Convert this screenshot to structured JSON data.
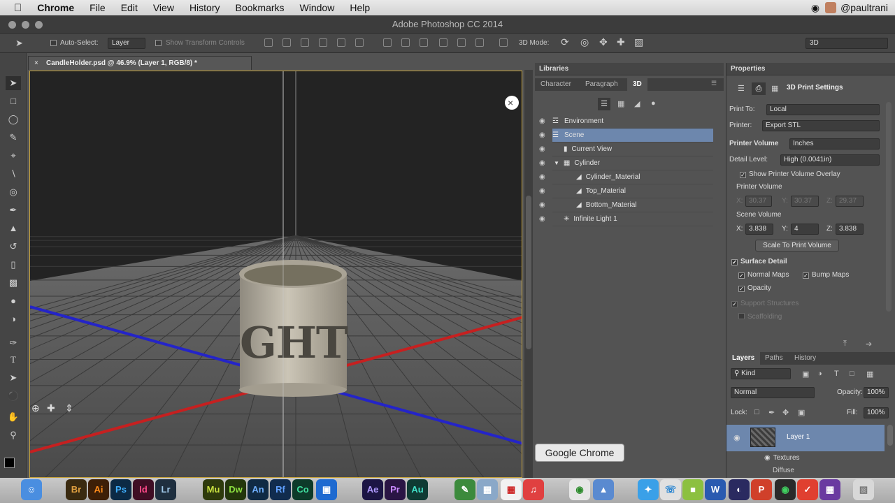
{
  "menubar": {
    "app": "Chrome",
    "items": [
      "File",
      "Edit",
      "View",
      "History",
      "Bookmarks",
      "Window",
      "Help"
    ],
    "user": "@paultrani"
  },
  "window": {
    "title": "Adobe Photoshop CC 2014"
  },
  "options": {
    "auto_select": "Auto-Select:",
    "auto_select_value": "Layer",
    "show_transform": "Show Transform Controls",
    "mode_3d": "3D Mode:",
    "workspace": "3D"
  },
  "document": {
    "tab": "CandleHolder.psd @ 46.9% (Layer 1, RGB/8) *",
    "cylinder_text": "GHT"
  },
  "panels": {
    "libraries": "Libraries",
    "tabs": [
      "Character",
      "Paragraph",
      "3D"
    ],
    "scene_items": [
      "Environment",
      "Scene",
      "Current View",
      "Cylinder",
      "Cylinder_Material",
      "Top_Material",
      "Bottom_Material",
      "Infinite Light 1"
    ]
  },
  "properties": {
    "header": "Properties",
    "title": "3D Print Settings",
    "print_to_label": "Print To:",
    "print_to": "Local",
    "printer_label": "Printer:",
    "printer": "Export STL",
    "printer_volume_label": "Printer Volume",
    "printer_volume_unit": "Inches",
    "detail_label": "Detail Level:",
    "detail": "High (0.0041in)",
    "show_overlay": "Show Printer Volume Overlay",
    "printer_volume": "Printer Volume",
    "pv": {
      "x_label": "X:",
      "x": "30.37",
      "y_label": "Y:",
      "y": "30.37",
      "z_label": "Z:",
      "z": "29.37"
    },
    "scene_volume": "Scene Volume",
    "sv": {
      "x_label": "X:",
      "x": "3.838",
      "y_label": "Y:",
      "y": "4",
      "z_label": "Z:",
      "z": "3.838"
    },
    "scale_button": "Scale To Print Volume",
    "surface_detail": "Surface Detail",
    "normal_maps": "Normal Maps",
    "bump_maps": "Bump Maps",
    "opacity": "Opacity",
    "support_structures": "Support Structures",
    "scaffolding": "Scaffolding"
  },
  "layers": {
    "tabs": [
      "Layers",
      "Paths",
      "History"
    ],
    "filter": "Kind",
    "blend": "Normal",
    "opacity_label": "Opacity:",
    "opacity": "100%",
    "lock_label": "Lock:",
    "fill_label": "Fill:",
    "fill": "100%",
    "layer_name": "Layer 1",
    "textures": "Textures",
    "diffuse": "Diffuse"
  },
  "tooltip": "Google Chrome",
  "dock": [
    {
      "t": "Br",
      "c": "#3a2a10"
    },
    {
      "t": "Ai",
      "c": "#3d1f07"
    },
    {
      "t": "Ps",
      "c": "#0c2a45"
    },
    {
      "t": "Id",
      "c": "#3f0e24"
    },
    {
      "t": "Lr",
      "c": "#1f2f3f"
    },
    {
      "t": "Mu",
      "c": "#2e3a0c"
    },
    {
      "t": "Dw",
      "c": "#24360c"
    },
    {
      "t": "An",
      "c": "#102a44"
    },
    {
      "t": "Rf",
      "c": "#112c4e"
    },
    {
      "t": "Co",
      "c": "#0d3a2a"
    },
    {
      "t": "Ae",
      "c": "#1c1544"
    },
    {
      "t": "Pr",
      "c": "#2a1544"
    },
    {
      "t": "Au",
      "c": "#0f3a33"
    }
  ]
}
